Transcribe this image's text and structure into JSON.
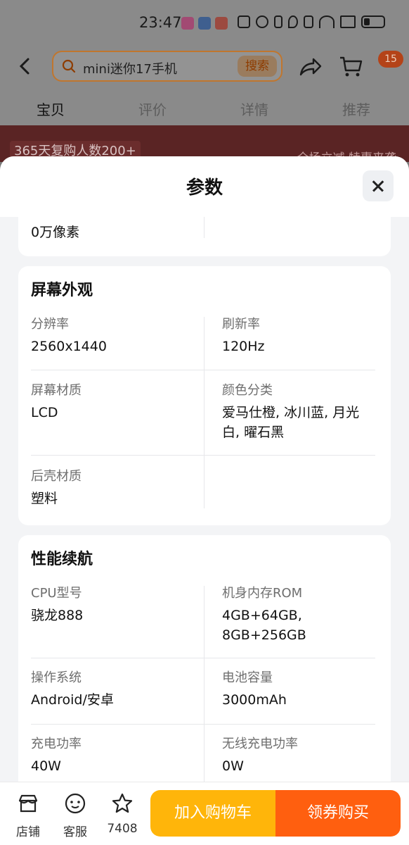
{
  "status": {
    "time": "23:47"
  },
  "topbar": {
    "search_text": "mini迷你17手机",
    "search_button": "搜索",
    "cart_badge": "15"
  },
  "tabs": [
    {
      "label": "宝贝"
    },
    {
      "label": "评价"
    },
    {
      "label": "详情"
    },
    {
      "label": "推荐"
    }
  ],
  "banner": {
    "left": "365天复购人数200+",
    "right": "全场立减 特惠来袭"
  },
  "sheet": {
    "title": "参数",
    "partial_row": {
      "value": "0万像素"
    },
    "screen": {
      "title": "屏幕外观",
      "rows": [
        [
          {
            "label": "分辨率",
            "value": "2560x1440"
          },
          {
            "label": "刷新率",
            "value": "120Hz"
          }
        ],
        [
          {
            "label": "屏幕材质",
            "value": "LCD"
          },
          {
            "label": "颜色分类",
            "value": "爱马仕橙, 冰川蓝, 月光白, 曜石黑"
          }
        ],
        [
          {
            "label": "后壳材质",
            "value": "塑料"
          },
          {
            "label": "",
            "value": ""
          }
        ]
      ]
    },
    "performance": {
      "title": "性能续航",
      "rows": [
        [
          {
            "label": "CPU型号",
            "value": "骁龙888"
          },
          {
            "label": "机身内存ROM",
            "value": "4GB+64GB, 8GB+256GB"
          }
        ],
        [
          {
            "label": "操作系统",
            "value": "Android/安卓"
          },
          {
            "label": "电池容量",
            "value": "3000mAh"
          }
        ],
        [
          {
            "label": "充电功率",
            "value": "40W"
          },
          {
            "label": "无线充电功率",
            "value": "0W"
          }
        ]
      ]
    }
  },
  "bottom": {
    "store": "店铺",
    "service": "客服",
    "favorites": "7408",
    "add_to_cart": "加入购物车",
    "buy": "领券购买"
  },
  "colors": {
    "accent_orange": "#ff5f0f",
    "accent_yellow": "#ffb50a"
  }
}
